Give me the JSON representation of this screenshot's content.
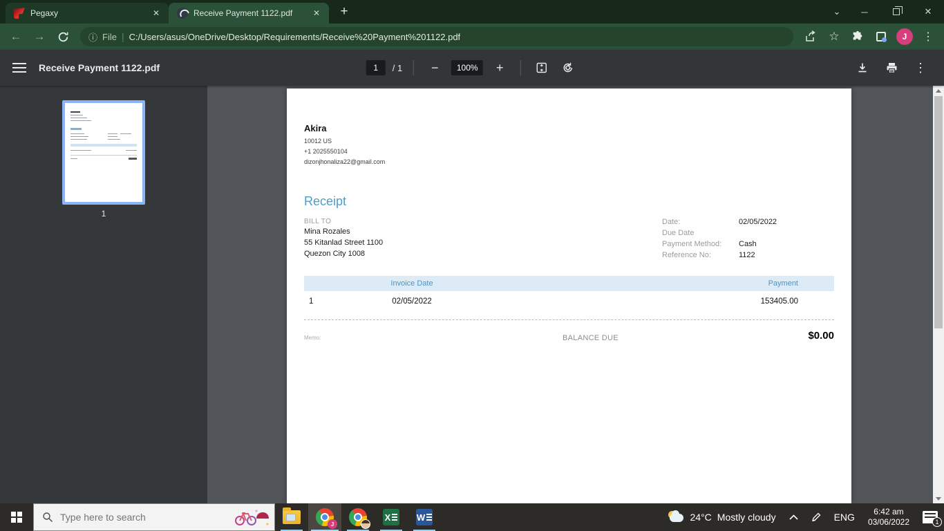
{
  "browser": {
    "tabs": [
      {
        "title": "Pegaxy"
      },
      {
        "title": "Receive Payment 1122.pdf"
      }
    ],
    "new_tab_label": "+",
    "address": {
      "file_label": "File",
      "separator": "|",
      "url": "C:/Users/asus/OneDrive/Desktop/Requirements/Receive%20Payment%201122.pdf"
    },
    "avatar_letter": "J"
  },
  "pdf_toolbar": {
    "title": "Receive Payment 1122.pdf",
    "page_current": "1",
    "page_total": "/ 1",
    "zoom_level": "100%"
  },
  "sidebar": {
    "page_label": "1"
  },
  "receipt": {
    "business_name": "Akira",
    "address_line": "10012 US",
    "phone": "+1 2025550104",
    "email": "dizonjhonaliza22@gmail.com",
    "title": "Receipt",
    "bill_to_label": "BILL TO",
    "bill_to_name": "Mina Rozales",
    "bill_to_street": "55 Kitanlad Street 1100",
    "bill_to_city": "Quezon City  1008",
    "meta": [
      {
        "label": "Date:",
        "value": "02/05/2022"
      },
      {
        "label": "Due Date",
        "value": ""
      },
      {
        "label": "Payment Method:",
        "value": "Cash"
      },
      {
        "label": "Reference No:",
        "value": "1122"
      }
    ],
    "table": {
      "headers": [
        "Invoice Date",
        "Payment"
      ],
      "rows": [
        {
          "num": "1",
          "invoice_date": "02/05/2022",
          "payment": "153405.00"
        }
      ]
    },
    "memo_label": "Memo:",
    "balance_due_label": "BALANCE DUE",
    "balance_due_value": "$0.00"
  },
  "taskbar": {
    "search_placeholder": "Type here to search",
    "weather_temp": "24°C",
    "weather_desc": "Mostly cloudy",
    "language": "ENG",
    "time": "6:42 am",
    "date": "03/06/2022",
    "notification_count": "1"
  },
  "colors": {
    "theme_green_dark": "#16291b",
    "theme_green": "#2b5139",
    "url_pill_green": "#24452c",
    "pdf_toolbar_gray": "#323639",
    "viewer_bg": "#51555a",
    "sidebar_bg": "#33373a",
    "receipt_blue": "#4e9dc9",
    "table_header_bg": "#dcebf5",
    "table_header_text": "#4c94c4",
    "thumbnail_selection_blue": "#8ab4f8",
    "avatar_pink": "#d93d7b",
    "taskbar_bg": "#2d2b27"
  }
}
